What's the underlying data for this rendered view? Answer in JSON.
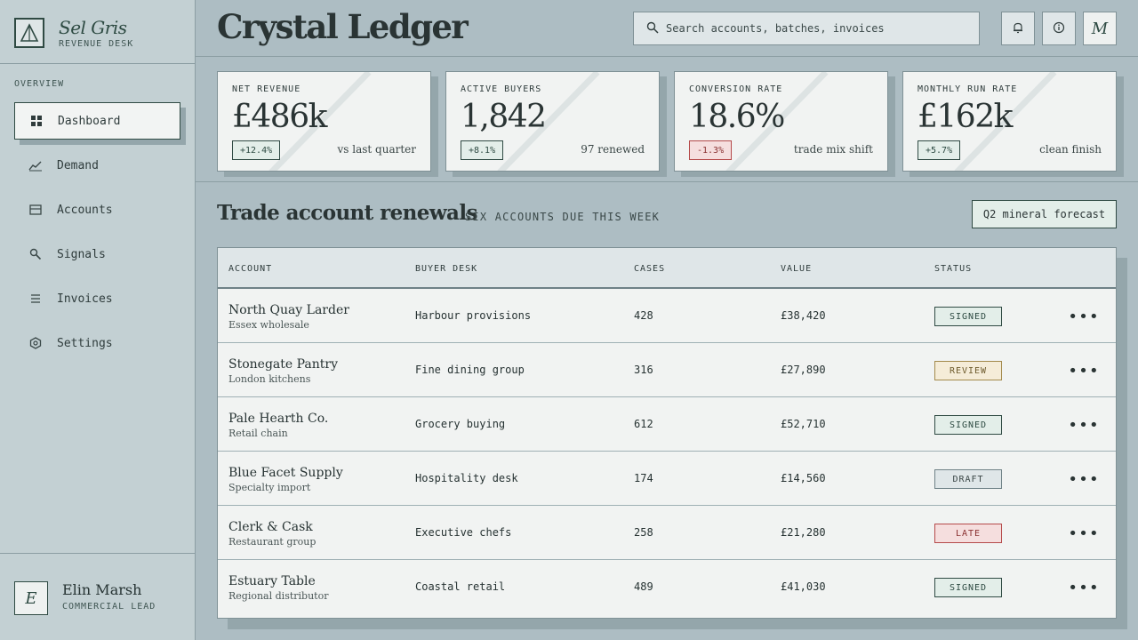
{
  "brand": {
    "name": "Sel Gris",
    "subtitle": "REVENUE DESK"
  },
  "sidebar": {
    "heading": "OVERVIEW",
    "items": [
      {
        "label": "Dashboard",
        "icon": "grid-icon",
        "active": true
      },
      {
        "label": "Demand",
        "icon": "trend-line-icon"
      },
      {
        "label": "Accounts",
        "icon": "card-icon"
      },
      {
        "label": "Signals",
        "icon": "search-signal-icon"
      },
      {
        "label": "Invoices",
        "icon": "list-icon"
      },
      {
        "label": "Settings",
        "icon": "hex-gear-icon"
      }
    ]
  },
  "user": {
    "initial": "E",
    "name": "Elin Marsh",
    "role": "COMMERCIAL LEAD"
  },
  "header": {
    "title": "Crystal Ledger",
    "search_placeholder": "Search accounts, batches, invoices",
    "profile_initial": "M"
  },
  "kpis": [
    {
      "label": "NET REVENUE",
      "value": "£486k",
      "delta": "+12.4%",
      "negative": false,
      "note": "vs last quarter"
    },
    {
      "label": "ACTIVE BUYERS",
      "value": "1,842",
      "delta": "+8.1%",
      "negative": false,
      "note": "97 renewed"
    },
    {
      "label": "CONVERSION RATE",
      "value": "18.6%",
      "delta": "-1.3%",
      "negative": true,
      "note": "trade mix shift"
    },
    {
      "label": "MONTHLY RUN RATE",
      "value": "£162k",
      "delta": "+5.7%",
      "negative": false,
      "note": "clean finish"
    }
  ],
  "section": {
    "title": "Trade account renewals",
    "subtitle": "SIX ACCOUNTS DUE THIS WEEK",
    "action_label": "Q2 mineral forecast"
  },
  "table": {
    "columns": [
      "ACCOUNT",
      "BUYER DESK",
      "CASES",
      "VALUE",
      "STATUS"
    ],
    "rows": [
      {
        "account": "North Quay Larder",
        "region": "Essex wholesale",
        "desk": "Harbour provisions",
        "cases": "428",
        "value": "£38,420",
        "status": "SIGNED",
        "tone": "signed"
      },
      {
        "account": "Stonegate Pantry",
        "region": "London kitchens",
        "desk": "Fine dining group",
        "cases": "316",
        "value": "£27,890",
        "status": "REVIEW",
        "tone": "review"
      },
      {
        "account": "Pale Hearth Co.",
        "region": "Retail chain",
        "desk": "Grocery buying",
        "cases": "612",
        "value": "£52,710",
        "status": "SIGNED",
        "tone": "signed"
      },
      {
        "account": "Blue Facet Supply",
        "region": "Specialty import",
        "desk": "Hospitality desk",
        "cases": "174",
        "value": "£14,560",
        "status": "DRAFT",
        "tone": "draft"
      },
      {
        "account": "Clerk & Cask",
        "region": "Restaurant group",
        "desk": "Executive chefs",
        "cases": "258",
        "value": "£21,280",
        "status": "LATE",
        "tone": "late"
      },
      {
        "account": "Estuary Table",
        "region": "Regional distributor",
        "desk": "Coastal retail",
        "cases": "489",
        "value": "£41,030",
        "status": "SIGNED",
        "tone": "signed"
      }
    ]
  },
  "colors": {
    "accent": "#2f4a43",
    "background": "#adbdc3",
    "sidebar": "#c3d0d3",
    "card": "#f1f3f2",
    "late": "#b54a4a",
    "review": "#a38a4c"
  }
}
